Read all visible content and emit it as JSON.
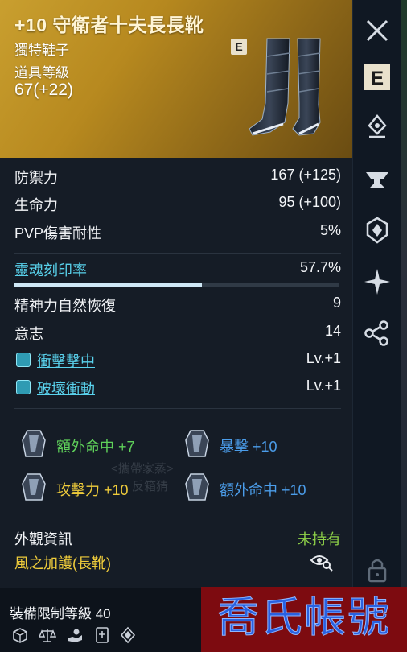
{
  "item": {
    "title": "+10 守衛者十夫長長靴",
    "type": "獨特鞋子",
    "level_label": "道具等級",
    "level_value": "67(+22)",
    "grade_badge": "E"
  },
  "stats": [
    {
      "label": "防禦力",
      "value": "167 (+125)"
    },
    {
      "label": "生命力",
      "value": "95 (+100)"
    },
    {
      "label": "PVP傷害耐性",
      "value": "5%"
    }
  ],
  "soul": {
    "label": "靈魂刻印率",
    "value": "57.7%",
    "fill": 0.577
  },
  "secondary": [
    {
      "label": "精神力自然恢復",
      "value": "9"
    },
    {
      "label": "意志",
      "value": "14"
    }
  ],
  "skills": [
    {
      "label": "衝擊擊中",
      "value": "Lv.+1"
    },
    {
      "label": "破壞衝動",
      "value": "Lv.+1"
    }
  ],
  "bonuses": [
    {
      "label": "額外命中 +7",
      "color": "#5fd15a"
    },
    {
      "label": "暴擊 +10",
      "color": "#4b9dea"
    },
    {
      "label": "攻擊力 +10",
      "color": "#efcc3b"
    },
    {
      "label": "額外命中 +10",
      "color": "#4b9dea"
    }
  ],
  "watermark": [
    "<攜帶家蒸>",
    "反箱猜"
  ],
  "appearance": {
    "label": "外觀資訊",
    "status": "未持有",
    "wind": "風之加護(長靴)"
  },
  "footer": {
    "equip_limit": "裝備限制等級 40"
  },
  "sidebar": {
    "e_label": "E"
  },
  "stamp": {
    "text": "喬氏帳號"
  },
  "colors": {
    "header": "#b7891f",
    "cyan": "#58d0ea",
    "green": "#5fd15a",
    "yellow": "#efcc3b",
    "blue": "#4b9dea",
    "stamp_bg": "#7d0b10",
    "stamp_text": "#2a61e0"
  }
}
